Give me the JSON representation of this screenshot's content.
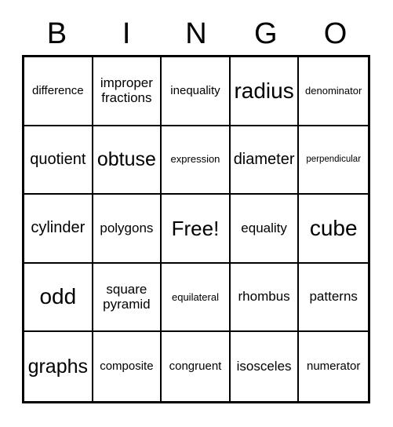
{
  "card": {
    "type": "bingo-card",
    "columns": 5,
    "rows": 5,
    "header": {
      "letters": [
        "B",
        "I",
        "N",
        "G",
        "O"
      ]
    },
    "free_space": {
      "label": "Free!",
      "row": 2,
      "column": 2
    },
    "colors": {
      "background": "#ffffff",
      "text": "#000000",
      "border": "#000000"
    },
    "cells": [
      [
        {
          "text": "difference",
          "size": "sm"
        },
        {
          "text": "improper\nfractions",
          "size": "md"
        },
        {
          "text": "inequality",
          "size": "sm"
        },
        {
          "text": "radius",
          "size": "xxl"
        },
        {
          "text": "denominator",
          "size": "xs"
        }
      ],
      [
        {
          "text": "quotient",
          "size": "lg"
        },
        {
          "text": "obtuse",
          "size": "xl"
        },
        {
          "text": "expression",
          "size": "xs"
        },
        {
          "text": "diameter",
          "size": "lg"
        },
        {
          "text": "perpendicular",
          "size": "xxs"
        }
      ],
      [
        {
          "text": "cylinder",
          "size": "lg"
        },
        {
          "text": "polygons",
          "size": "md"
        },
        {
          "text": "Free!",
          "size": "free"
        },
        {
          "text": "equality",
          "size": "md"
        },
        {
          "text": "cube",
          "size": "xxl"
        }
      ],
      [
        {
          "text": "odd",
          "size": "xxl"
        },
        {
          "text": "square\npyramid",
          "size": "md"
        },
        {
          "text": "equilateral",
          "size": "xs"
        },
        {
          "text": "rhombus",
          "size": "md"
        },
        {
          "text": "patterns",
          "size": "md"
        }
      ],
      [
        {
          "text": "graphs",
          "size": "xl"
        },
        {
          "text": "composite",
          "size": "sm"
        },
        {
          "text": "congruent",
          "size": "sm"
        },
        {
          "text": "isosceles",
          "size": "md"
        },
        {
          "text": "numerator",
          "size": "sm"
        }
      ]
    ]
  }
}
